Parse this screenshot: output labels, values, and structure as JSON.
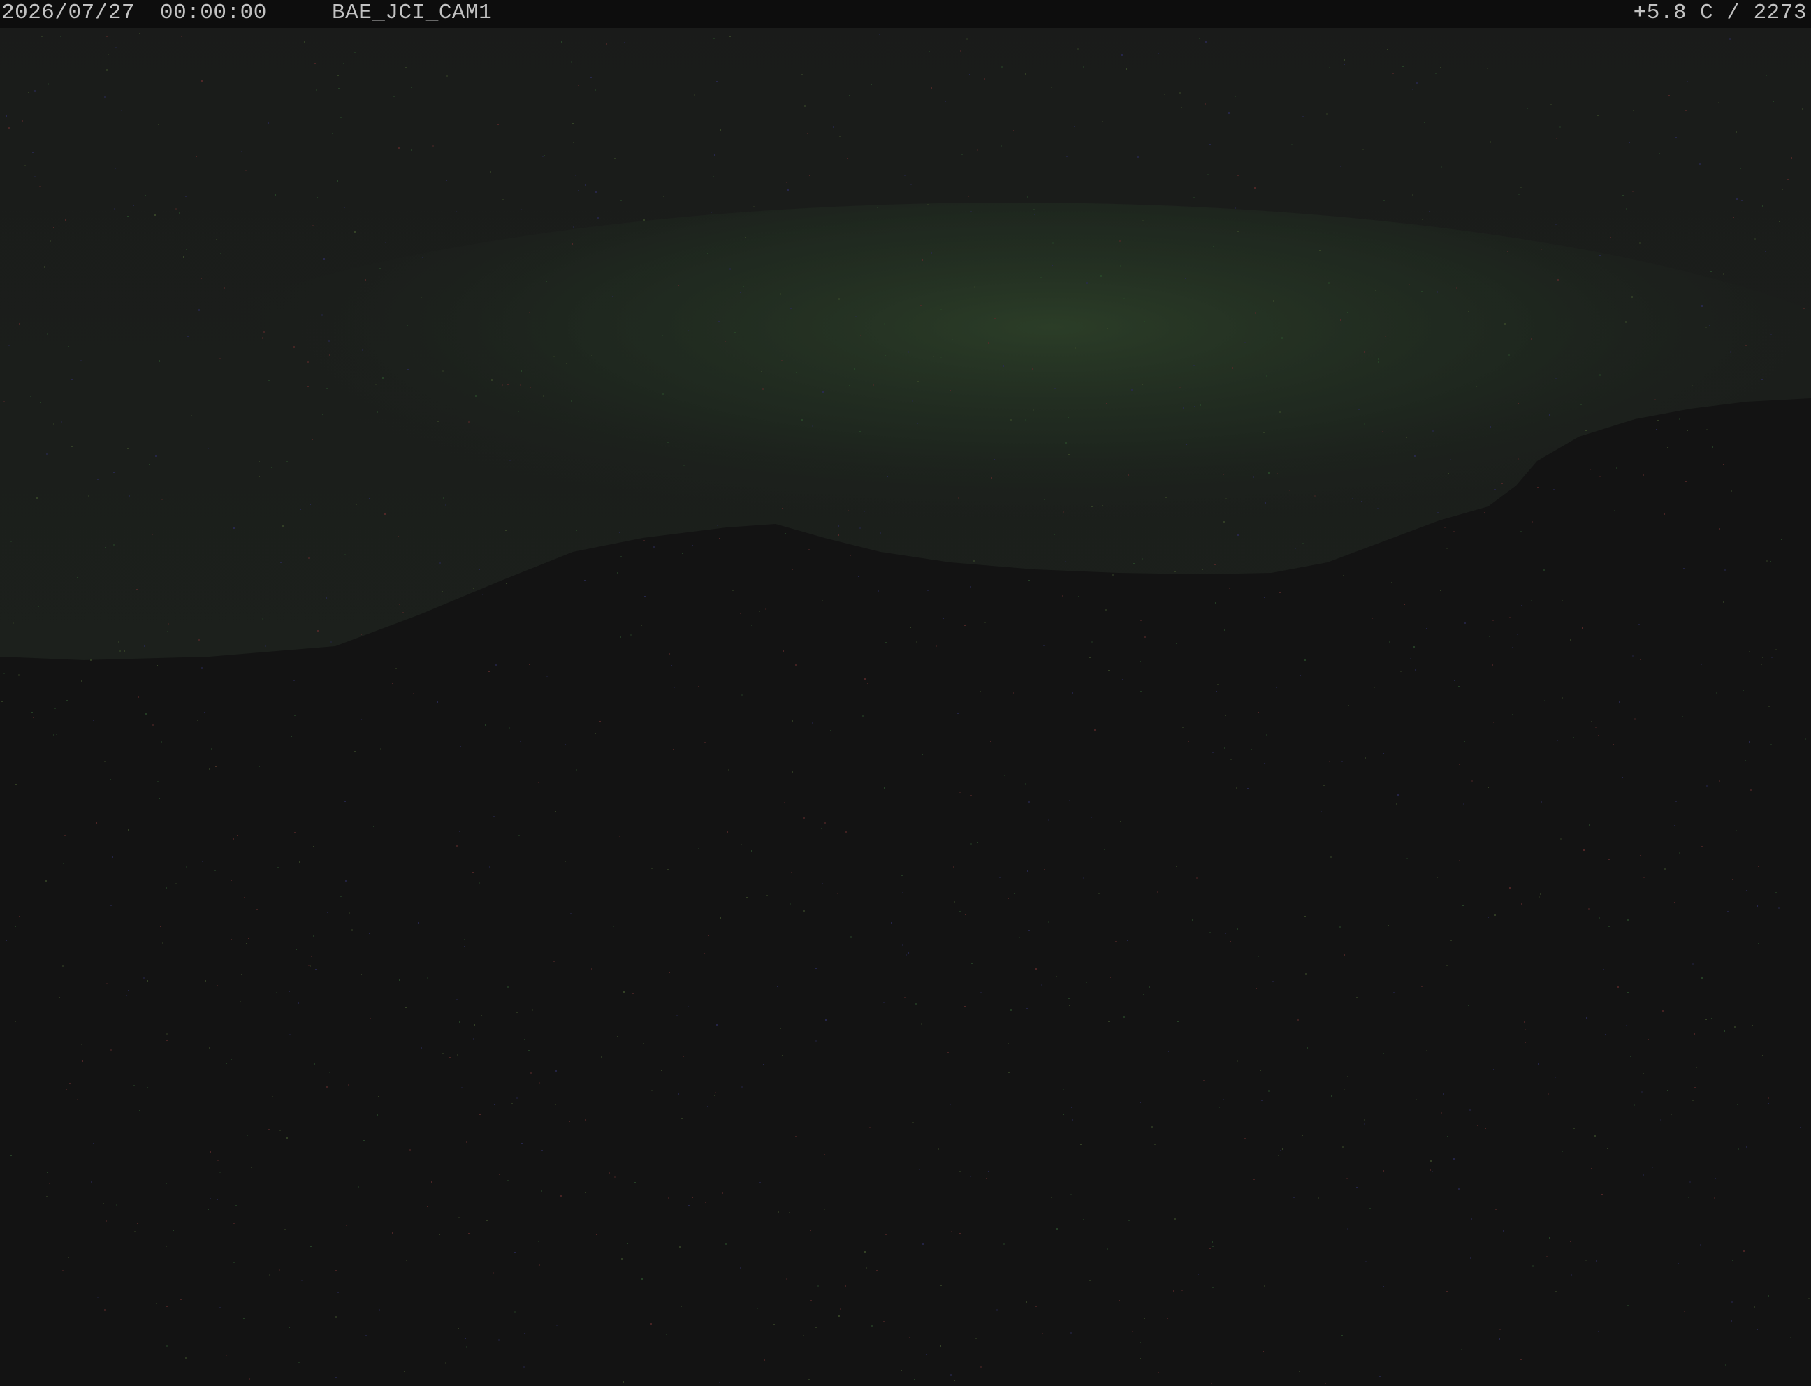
{
  "overlay": {
    "date": "2026/07/27",
    "time": "00:00:00",
    "camera_id": "BAE_JCI_CAM1",
    "readout": "+5.8 C / 2273"
  },
  "colors": {
    "overlay_bar": "#0d0d0d",
    "overlay_text": "#c2c2c2",
    "sky": "#1b1d1b",
    "sky_glow": "#243424",
    "ground": "#131313",
    "ridge": "#141414"
  }
}
